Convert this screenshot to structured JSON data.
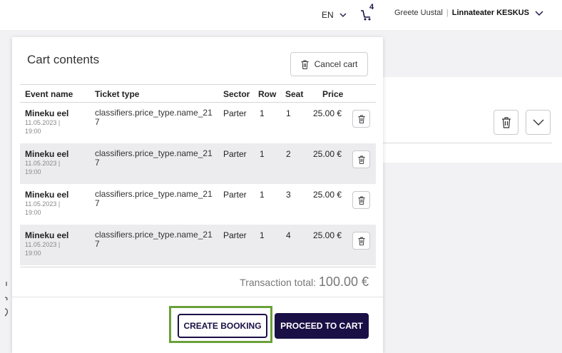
{
  "header": {
    "language": "EN",
    "cart_count": "4",
    "user_name": "Greete Uustal",
    "separator": "|",
    "organization": "Linnateater KESKUS"
  },
  "cart": {
    "title": "Cart contents",
    "cancel_label": "Cancel cart",
    "columns": [
      "Event name",
      "Ticket type",
      "Sector",
      "Row",
      "Seat",
      "Price"
    ],
    "rows": [
      {
        "event": "Mineku eel",
        "date": "11.05.2023 |",
        "time": "19:00",
        "ticket_type": "classifiers.price_type.name_217",
        "sector": "Parter",
        "row": "1",
        "seat": "1",
        "price": "25.00 €"
      },
      {
        "event": "Mineku eel",
        "date": "11.05.2023 |",
        "time": "19:00",
        "ticket_type": "classifiers.price_type.name_217",
        "sector": "Parter",
        "row": "1",
        "seat": "2",
        "price": "25.00 €"
      },
      {
        "event": "Mineku eel",
        "date": "11.05.2023 |",
        "time": "19:00",
        "ticket_type": "classifiers.price_type.name_217",
        "sector": "Parter",
        "row": "1",
        "seat": "3",
        "price": "25.00 €"
      },
      {
        "event": "Mineku eel",
        "date": "11.05.2023 |",
        "time": "19:00",
        "ticket_type": "classifiers.price_type.name_217",
        "sector": "Parter",
        "row": "1",
        "seat": "4",
        "price": "25.00 €"
      }
    ],
    "total_label": "Transaction total:",
    "total_value": "100.00 €",
    "create_booking_label": "CREATE BOOKING",
    "proceed_label": "PROCEED TO CART"
  },
  "colors": {
    "primary": "#1a1046",
    "highlight": "#6aa13a",
    "row_alt": "#ececef"
  },
  "icons": [
    "chevron-down-icon",
    "cart-icon",
    "trash-icon"
  ]
}
